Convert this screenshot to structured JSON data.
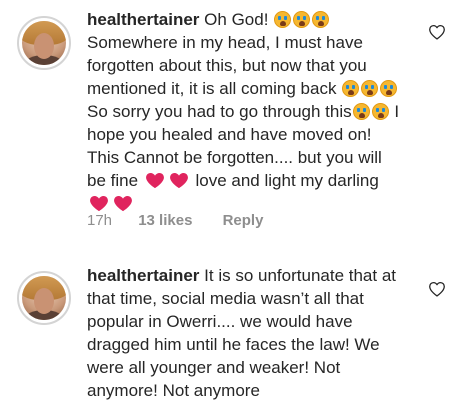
{
  "comments": [
    {
      "username": "healthertainer",
      "segments": [
        {
          "type": "text",
          "value": "Oh God! "
        },
        {
          "type": "emoji",
          "name": "crying-face-emoji"
        },
        {
          "type": "emoji",
          "name": "crying-face-emoji"
        },
        {
          "type": "emoji",
          "name": "crying-face-emoji"
        },
        {
          "type": "text",
          "value": " Somewhere in my head, I must have forgotten about this, but now that you mentioned it, it is all coming back "
        },
        {
          "type": "emoji",
          "name": "crying-face-emoji"
        },
        {
          "type": "emoji",
          "name": "crying-face-emoji"
        },
        {
          "type": "emoji",
          "name": "crying-face-emoji"
        },
        {
          "type": "text",
          "value": " So sorry you had to go through this"
        },
        {
          "type": "emoji",
          "name": "crying-face-emoji"
        },
        {
          "type": "emoji",
          "name": "crying-face-emoji"
        },
        {
          "type": "text",
          "value": " I hope you healed and have moved on! This Cannot be forgotten.... but you will be fine "
        },
        {
          "type": "heart",
          "name": "heart-emoji"
        },
        {
          "type": "heart",
          "name": "heart-emoji"
        },
        {
          "type": "text",
          "value": " love and light my darling "
        },
        {
          "type": "heart",
          "name": "heart-emoji"
        },
        {
          "type": "heart",
          "name": "heart-emoji"
        }
      ],
      "time": "17h",
      "likes": "13 likes",
      "reply": "Reply"
    },
    {
      "username": "healthertainer",
      "text": "It is so unfortunate that at that time, social media wasn’t all that popular in Owerri.... we would have dragged him until he faces the law! We were all younger and weaker! Not anymore! Not anymore"
    }
  ],
  "colors": {
    "text": "#262626",
    "meta": "#8e8e8e",
    "heart": "#e0245e",
    "emoji": "#f6b730"
  },
  "icons": {
    "like": "heart-outline-icon"
  }
}
